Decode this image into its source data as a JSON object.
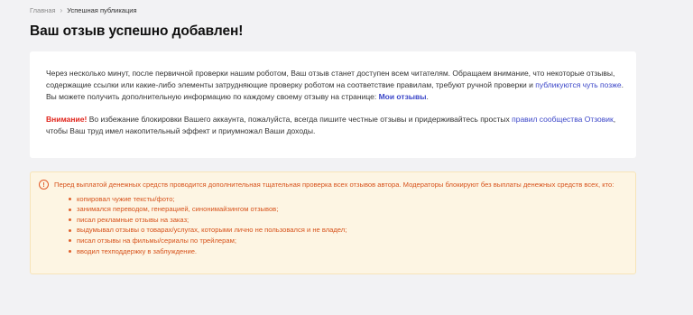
{
  "breadcrumb": {
    "home": "Главная",
    "separator": "›",
    "current": "Успешная публикация"
  },
  "page": {
    "title": "Ваш отзыв успешно добавлен!"
  },
  "info_card": {
    "text_part1": "Через несколько минут, после первичной проверки нашим роботом, Ваш отзыв станет доступен всем читателям. Обращаем внимание, что некоторые отзывы, содержащие ссылки или какие-либо элементы затрудняющие проверку роботом на соответствие правилам, требуют ручной проверки и ",
    "published_later_link": "публикуются чуть позже",
    "text_part2": ". Вы можете получить дополнительную информацию по каждому своему отзыву на странице: ",
    "my_reviews_link": "Мои отзывы",
    "text_part3": ".",
    "attention_label": "Внимание!",
    "attention_text": " Во избежание блокировки Вашего аккаунта, пожалуйста, всегда пишите честные отзывы и придерживайтесь простых ",
    "rules_link": "правил сообщества Отзовик",
    "attention_text_end": ", чтобы Ваш труд имел накопительный эффект и приумножал Ваши доходы."
  },
  "warning": {
    "icon": "!",
    "intro": "Перед выплатой денежных средств проводится дополнительная тщательная проверка всех отзывов автора. Модераторы блокируют без выплаты денежных средств всех, кто:",
    "items": [
      "копировал чужие тексты/фото;",
      "занимался переводом, генерацией, синонимайзингом отзывов;",
      "писал рекламные отзывы на заказ;",
      "выдумывал отзывы о товарах/услугах, которыми лично не пользовался и не владел;",
      "писал отзывы на фильмы/сериалы по трейлерам;",
      "вводил техподдержку в заблуждение."
    ]
  },
  "colors": {
    "link": "#3b46c8",
    "attention": "#e0241b",
    "warning_text": "#d7531c",
    "warning_bg": "#fdf5e3"
  }
}
